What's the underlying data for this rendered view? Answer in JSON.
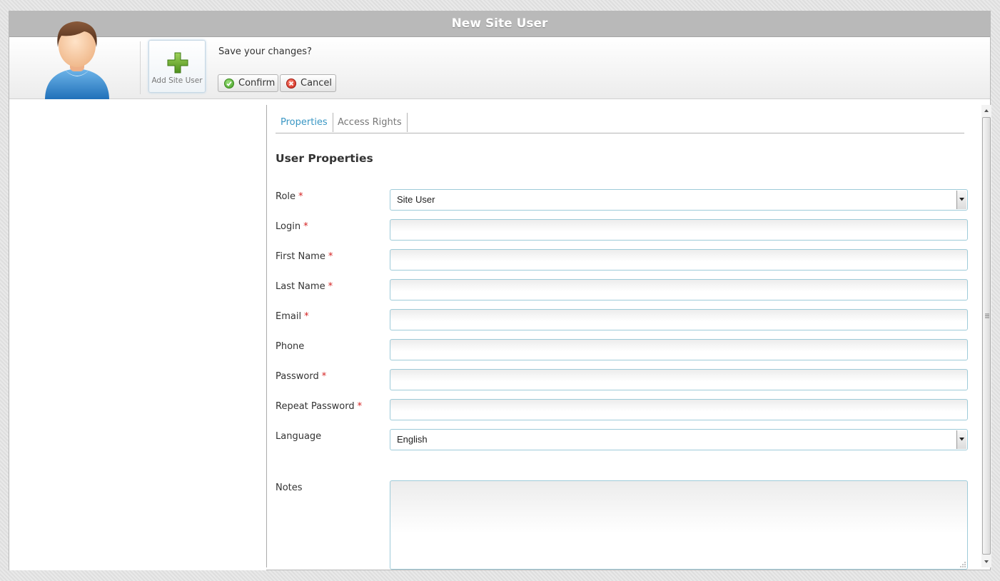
{
  "window": {
    "title": "New Site User"
  },
  "toolbar": {
    "add_button_label": "Add Site User",
    "prompt": "Save your changes?",
    "confirm_label": "Confirm",
    "cancel_label": "Cancel"
  },
  "tabs": [
    {
      "label": "Properties",
      "active": true
    },
    {
      "label": "Access Rights",
      "active": false
    }
  ],
  "form": {
    "title": "User Properties",
    "required_mark": "*",
    "fields": [
      {
        "label": "Role",
        "required": true,
        "type": "select",
        "value": "Site User"
      },
      {
        "label": "Login",
        "required": true,
        "type": "text",
        "value": ""
      },
      {
        "label": "First Name",
        "required": true,
        "type": "text",
        "value": ""
      },
      {
        "label": "Last Name",
        "required": true,
        "type": "text",
        "value": ""
      },
      {
        "label": "Email",
        "required": true,
        "type": "text",
        "value": ""
      },
      {
        "label": "Phone",
        "required": false,
        "type": "text",
        "value": ""
      },
      {
        "label": "Password",
        "required": true,
        "type": "password",
        "value": ""
      },
      {
        "label": "Repeat Password",
        "required": true,
        "type": "password",
        "value": ""
      },
      {
        "label": "Language",
        "required": false,
        "type": "select",
        "value": "English"
      },
      {
        "label": "Notes",
        "required": false,
        "type": "textarea",
        "value": ""
      }
    ]
  },
  "colors": {
    "accent": "#3a97c4",
    "required": "#d42020",
    "field_border": "#9ecbd9"
  }
}
